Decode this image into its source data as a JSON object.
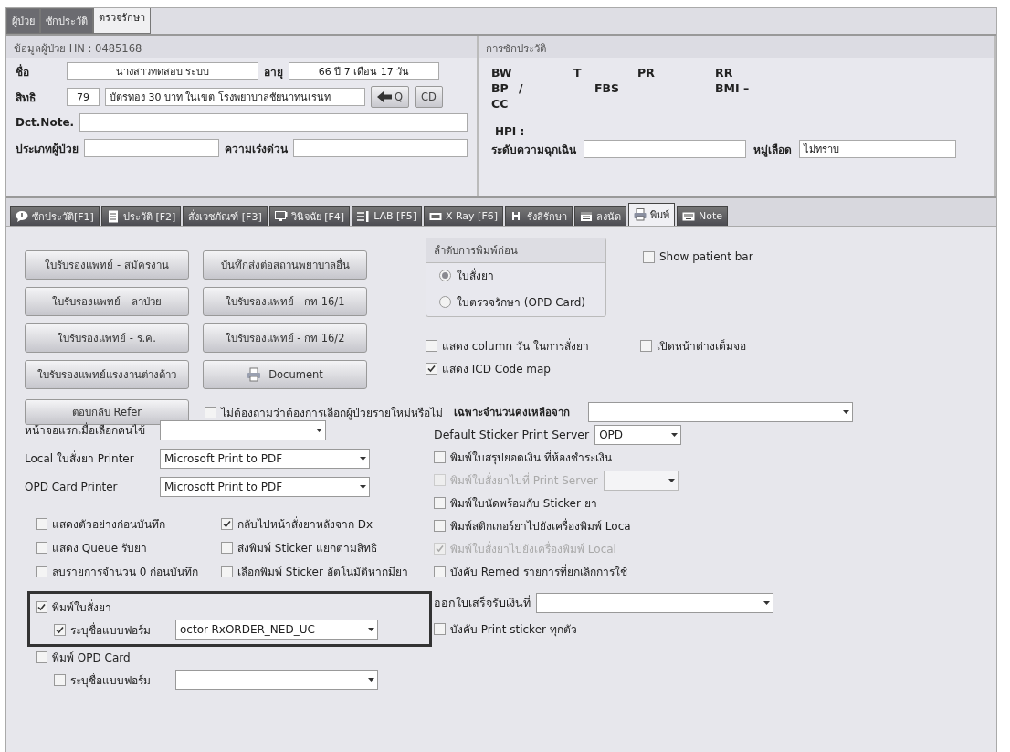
{
  "top_tabs": [
    {
      "label": "ผู้ป่วย",
      "selected": false
    },
    {
      "label": "ซักประวัติ",
      "selected": false
    },
    {
      "label": "ตรวจรักษา",
      "selected": true
    }
  ],
  "patient": {
    "title": "ข้อมูลผู้ป่วย HN : 0485168",
    "name_label": "ชื่อ",
    "name": "นางสาวทดสอบ ระบบ",
    "age_label": "อายุ",
    "age": "66 ปี 7 เดือน 17 วัน",
    "right_label": "สิทธิ",
    "right_code": "79",
    "right_name": "บัตรทอง 30 บาท ในเขต โรงพยาบาลชัยนาทนเรนท",
    "q_button": "Q",
    "cd_button": "CD",
    "note_label": "Dct.Note.",
    "type_label": "ประเภทผู้ป่วย",
    "urgency_label": "ความเร่งด่วน"
  },
  "history": {
    "title": "การซักประวัติ",
    "vitals": [
      [
        "BW",
        "T",
        "PR",
        "RR"
      ],
      [
        "BP",
        "/",
        "FBS",
        "BMI –"
      ],
      [
        "CC"
      ]
    ],
    "hpi_label": "HPI :",
    "emergency_label": "ระดับความฉุกเฉิน",
    "blood_label": "หมู่เลือด",
    "blood_value": "ไม่ทราบ"
  },
  "main_tabs": [
    {
      "label": "ซักประวัติ[F1]",
      "selected": false
    },
    {
      "label": "ประวัติ [F2]",
      "selected": false
    },
    {
      "label": "สั่งเวชภัณฑ์ [F3]",
      "selected": false
    },
    {
      "label": "วินิจฉัย [F4]",
      "selected": false
    },
    {
      "label": "LAB [F5]",
      "selected": false
    },
    {
      "label": "X-Ray [F6]",
      "selected": false
    },
    {
      "label": "รังสีรักษา",
      "selected": false
    },
    {
      "label": "ลงนัด",
      "selected": false
    },
    {
      "label": "พิมพ์",
      "selected": true
    },
    {
      "label": "Note",
      "selected": false
    }
  ],
  "print_page": {
    "button_rows": [
      [
        {
          "label": "ใบรับรองแพทย์ - สมัครงาน",
          "kind": "plain"
        },
        {
          "label": "บันทึกส่งต่อสถานพยาบาลอื่น",
          "kind": "plain"
        }
      ],
      [
        {
          "label": "ใบรับรองแพทย์ - ลาป่วย",
          "kind": "plain"
        },
        {
          "label": "ใบรับรองแพทย์ - กท 16/1",
          "kind": "plain"
        }
      ],
      [
        {
          "label": "ใบรับรองแพทย์ - ร.ค.",
          "kind": "plain"
        },
        {
          "label": "ใบรับรองแพทย์ - กท 16/2",
          "kind": "plain"
        }
      ],
      [
        {
          "label": "ใบรับรองแพทย์แรงงานต่างด้าว",
          "kind": "plain"
        },
        {
          "label": "Document",
          "kind": "print"
        }
      ]
    ],
    "print_order": {
      "title": "ลำดับการพิมพ์ก่อน",
      "options": [
        {
          "label": "ใบสั่งยา",
          "selected": true
        },
        {
          "label": "ใบตรวจรักษา (OPD Card)",
          "selected": false
        }
      ]
    },
    "show_patient_bar": {
      "label": "Show patient bar",
      "checked": false
    },
    "option_checks": [
      {
        "label": "แสดง column วัน ในการสั่งยา",
        "checked": false
      },
      {
        "label": "เปิดหน้าต่างเต็มจอ",
        "checked": false
      },
      {
        "label": "แสดง ICD Code map",
        "checked": true
      }
    ],
    "refer_button": {
      "label": "ตอบกลับ Refer"
    },
    "ask_check": {
      "label": "ไม่ต้องถามว่าต้องการเลือกผู้ป่วยรายใหม่หรือไม่",
      "checked": false
    },
    "stock_label": "เฉพาะจำนวนคงเหลือจาก",
    "left_selects": [
      {
        "label": "หน้าจอแรกเมื่อเลือกคนไข้"
      },
      {
        "label": "Local ใบสั่งยา Printer",
        "value": "Microsoft Print to PDF"
      },
      {
        "label": "OPD Card Printer",
        "value": "Microsoft Print to PDF"
      }
    ],
    "left_checks": [
      {
        "label": "แสดงตัวอย่างก่อนบันทึก",
        "checked": false
      },
      {
        "label": "กลับไปหน้าสั่งยาหลังจาก Dx",
        "checked": true
      },
      {
        "label": "แสดง Queue รับยา",
        "checked": false
      },
      {
        "label": "ส่งพิมพ์ Sticker แยกตามสิทธิ",
        "checked": false
      },
      {
        "label": "ลบรายการจำนวน 0 ก่อนบันทึก",
        "checked": false
      },
      {
        "label": "เลือกพิมพ์ Sticker อัตโนมัติหากมียา",
        "checked": false
      }
    ],
    "form_groups": [
      {
        "label": "พิมพ์ใบสั่งยา",
        "checked": true,
        "highlighted": true,
        "form": {
          "label": "ระบุชื่อแบบฟอร์ม",
          "checked": true,
          "value": "octor-RxORDER_NED_UC"
        }
      },
      {
        "label": "พิมพ์ OPD Card",
        "checked": false,
        "highlighted": false,
        "form": {
          "label": "ระบุชื่อแบบฟอร์ม",
          "checked": false
        }
      }
    ],
    "right_settings": [
      {
        "kind": "select",
        "label": "Default Sticker Print Server",
        "value": "OPD"
      },
      {
        "kind": "checkbox",
        "label": "พิมพ์ใบสรุปยอดเงิน ที่ห้องชำระเงิน",
        "checked": false,
        "disabled": false
      },
      {
        "kind": "checkbox",
        "label": "พิมพ์ใบสั่งยาไปที่ Print Server",
        "checked": false,
        "disabled": true,
        "with_select": true
      },
      {
        "kind": "checkbox",
        "label": "พิมพ์ใบนัดพร้อมกับ Sticker ยา",
        "checked": false,
        "disabled": false
      },
      {
        "kind": "checkbox",
        "label": "พิมพ์สติกเกอร์ยาไปยังเครื่องพิมพ์ Loca",
        "checked": false,
        "disabled": false
      },
      {
        "kind": "checkbox",
        "label": "พิมพ์ใบสั่งยาไปยังเครื่องพิมพ์ Local",
        "checked": true,
        "disabled": true
      },
      {
        "kind": "checkbox",
        "label": "บังคับ Remed รายการที่ยกเลิกการใช้",
        "checked": false,
        "disabled": false
      },
      {
        "kind": "select",
        "label": "ออกใบเสร็จรับเงินที่"
      },
      {
        "kind": "checkbox",
        "label": "บังคับ Print sticker ทุกตัว",
        "checked": false,
        "disabled": false
      }
    ]
  }
}
